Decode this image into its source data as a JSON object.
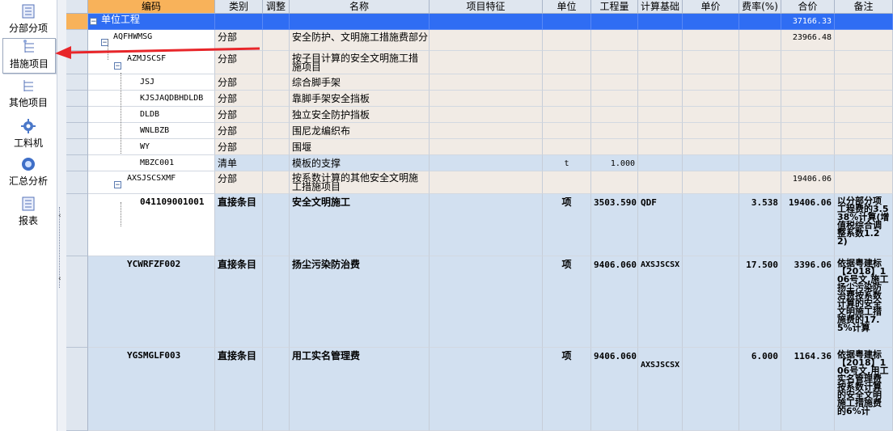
{
  "nav": {
    "items": [
      {
        "label": "分部分项",
        "icon": "list-icon"
      },
      {
        "label": "措施项目",
        "icon": "tree-icon"
      },
      {
        "label": "其他项目",
        "icon": "tree-icon"
      },
      {
        "label": "工料机",
        "icon": "gear-icon"
      },
      {
        "label": "汇总分析",
        "icon": "circle-icon"
      },
      {
        "label": "报表",
        "icon": "report-icon"
      }
    ],
    "active_index": 1
  },
  "colors": {
    "header_bg": "#dfe6ef",
    "selected_header": "#f8b25a",
    "selected_row": "#2f6df3",
    "fenbu_row": "#f1ebe5",
    "item_row": "#d2e0f0"
  },
  "grid": {
    "headers": [
      "编码",
      "类别",
      "调整",
      "名称",
      "项目特征",
      "单位",
      "工程量",
      "计算基础",
      "单价",
      "费率(%)",
      "合价",
      "备注"
    ],
    "rows": [
      {
        "code": "单位工程",
        "type": "",
        "adjust": "",
        "name": "",
        "feature": "",
        "unit": "",
        "qty": "",
        "base": "",
        "price": "",
        "rate": "",
        "total": "37166.33",
        "remark": ""
      },
      {
        "code": "AQFHWMSG",
        "type": "分部",
        "adjust": "",
        "name": "安全防护、文明施工措施费部分",
        "feature": "",
        "unit": "",
        "qty": "",
        "base": "",
        "price": "",
        "rate": "",
        "total": "23966.48",
        "remark": ""
      },
      {
        "code": "AZMJSCSF",
        "type": "分部",
        "adjust": "",
        "name": "按子目计算的安全文明施工措施项目",
        "feature": "",
        "unit": "",
        "qty": "",
        "base": "",
        "price": "",
        "rate": "",
        "total": "",
        "remark": ""
      },
      {
        "code": "JSJ",
        "type": "分部",
        "adjust": "",
        "name": "综合脚手架",
        "feature": "",
        "unit": "",
        "qty": "",
        "base": "",
        "price": "",
        "rate": "",
        "total": "",
        "remark": ""
      },
      {
        "code": "KJSJAQDBHDLDB",
        "type": "分部",
        "adjust": "",
        "name": "靠脚手架安全挡板",
        "feature": "",
        "unit": "",
        "qty": "",
        "base": "",
        "price": "",
        "rate": "",
        "total": "",
        "remark": ""
      },
      {
        "code": "DLDB",
        "type": "分部",
        "adjust": "",
        "name": "独立安全防护挡板",
        "feature": "",
        "unit": "",
        "qty": "",
        "base": "",
        "price": "",
        "rate": "",
        "total": "",
        "remark": ""
      },
      {
        "code": "WNLBZB",
        "type": "分部",
        "adjust": "",
        "name": "围尼龙编织布",
        "feature": "",
        "unit": "",
        "qty": "",
        "base": "",
        "price": "",
        "rate": "",
        "total": "",
        "remark": ""
      },
      {
        "code": "WY",
        "type": "分部",
        "adjust": "",
        "name": "围堰",
        "feature": "",
        "unit": "",
        "qty": "",
        "base": "",
        "price": "",
        "rate": "",
        "total": "",
        "remark": ""
      },
      {
        "code": "MBZC001",
        "type": "清单",
        "adjust": "",
        "name": "模板的支撑",
        "feature": "",
        "unit": "t",
        "qty": "1.000",
        "base": "",
        "price": "",
        "rate": "",
        "total": "",
        "remark": ""
      },
      {
        "code": "AXSJSCSXMF",
        "type": "分部",
        "adjust": "",
        "name": "按系数计算的其他安全文明施工措施项目",
        "feature": "",
        "unit": "",
        "qty": "",
        "base": "",
        "price": "",
        "rate": "",
        "total": "19406.06",
        "remark": ""
      },
      {
        "code": "041109001001",
        "type": "直接条目",
        "adjust": "",
        "name": "安全文明施工",
        "feature": "",
        "unit": "项",
        "qty": "3503.590",
        "base": "QDF",
        "price": "",
        "rate": "3.538",
        "total": "19406.06",
        "remark": "以分部分项工程费的3.538%计算(增值税综合调整系数1.22)"
      },
      {
        "code": "YCWRFZF002",
        "type": "直接条目",
        "adjust": "",
        "name": "扬尘污染防治费",
        "feature": "",
        "unit": "项",
        "qty": "9406.060",
        "base": "AXSJSCSX",
        "price": "",
        "rate": "17.500",
        "total": "3396.06",
        "remark": "依据粤建标【2018】106号文,施工扬尘污染防治费按系数计算的安全文明施工措施费的17.5%计算"
      },
      {
        "code": "YGSMGLF003",
        "type": "直接条目",
        "adjust": "",
        "name": "用工实名管理费",
        "feature": "",
        "unit": "项",
        "qty": "9406.060",
        "base": "AXSJSCSX",
        "price": "",
        "rate": "6.000",
        "total": "1164.36",
        "remark": "依据粤建标【2018】106号文,用工实名管理费按系数计算的安全文明施工措施费的6%计"
      }
    ]
  }
}
